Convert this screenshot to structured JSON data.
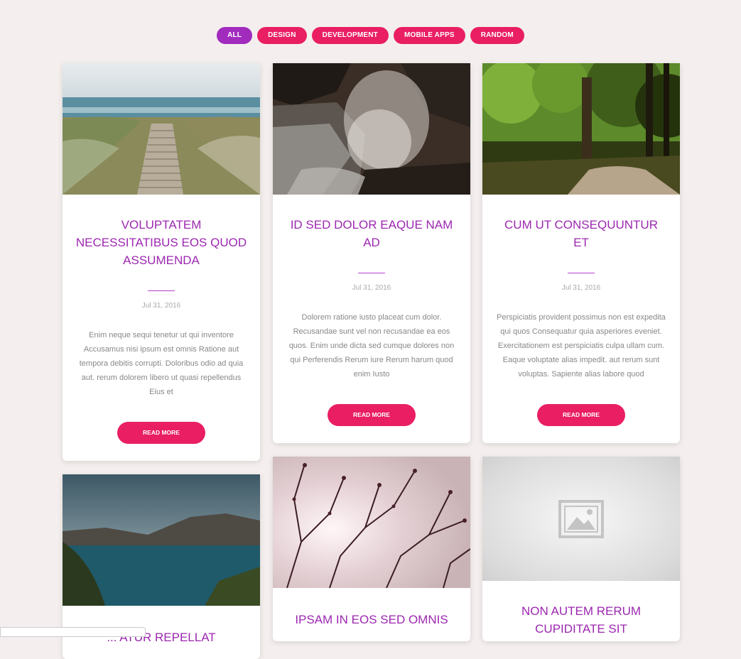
{
  "filters": [
    {
      "label": "All",
      "active": true
    },
    {
      "label": "Design"
    },
    {
      "label": "Development"
    },
    {
      "label": "Mobile Apps"
    },
    {
      "label": "Random"
    }
  ],
  "colors": {
    "accent": "#e91e63",
    "active": "#a12bbd",
    "title": "#9c27b0"
  },
  "cards": [
    {
      "image": "boardwalk-beach",
      "title": "Voluptatem necessitatibus eos quod assumenda",
      "date": "Jul 31, 2016",
      "excerpt": "Enim neque sequi tenetur ut qui inventore Accusamus nisi ipsum est omnis Ratione aut tempora debitis corrupti. Doloribus odio ad quia aut. rerum dolorem libero ut quasi repellendus Eius et",
      "button": "Read More"
    },
    {
      "image": "waterfall",
      "title": "Id sed dolor eaque nam ad",
      "date": "Jul 31, 2016",
      "excerpt": "Dolorem ratione iusto placeat cum dolor. Recusandae sunt vel non recusandae ea eos quos. Enim unde dicta sed cumque dolores non qui Perferendis Rerum iure Rerum harum quod enim Iusto",
      "button": "Read More"
    },
    {
      "image": "forest-path",
      "title": "Cum ut consequuntur et",
      "date": "Jul 31, 2016",
      "excerpt": "Perspiciatis provident possimus non est expedita qui quos Consequatur quia asperiores eveniet. Exercitationem est perspiciatis culpa ullam cum. Eaque voluptate alias impedit. aut rerum sunt voluptas. Sapiente alias labore quod",
      "button": "Read More"
    },
    {
      "image": "mountain-lake",
      "title": "... atur repellat"
    },
    {
      "image": "tree-branches",
      "title": "Ipsam in eos sed omnis"
    },
    {
      "image": "placeholder",
      "title": "Non autem rerum cupiditate sit"
    }
  ]
}
